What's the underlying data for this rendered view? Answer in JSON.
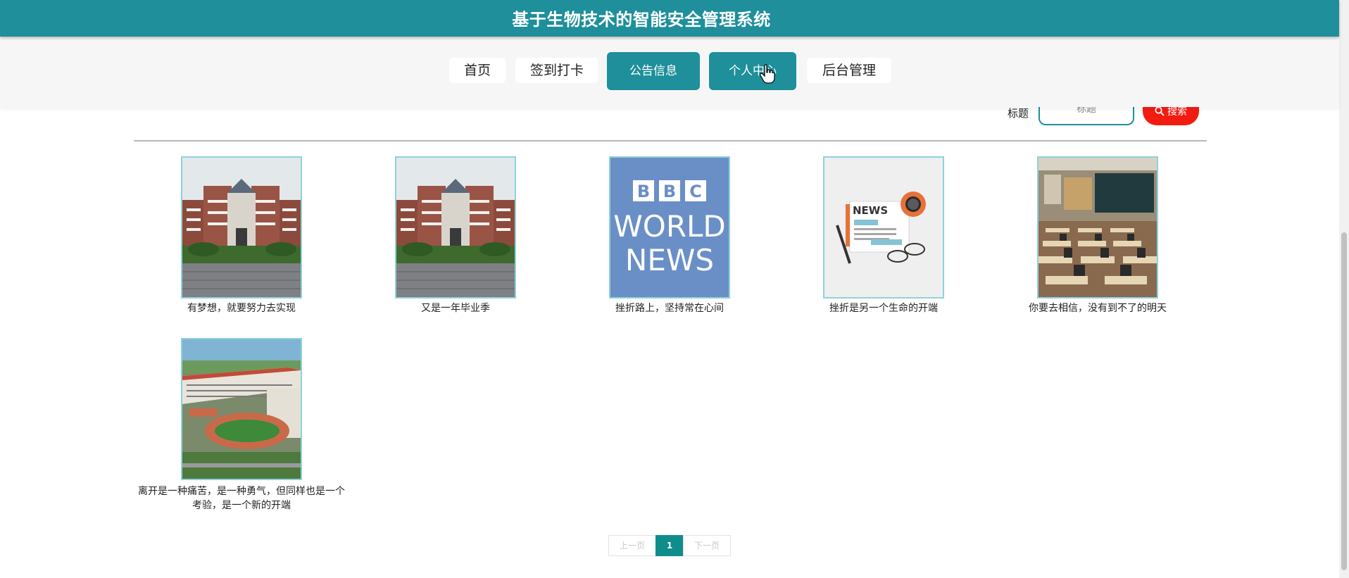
{
  "header": {
    "title": "基于生物技术的智能安全管理系统"
  },
  "nav": {
    "items": [
      {
        "label": "首页",
        "active": false
      },
      {
        "label": "签到打卡",
        "active": false
      },
      {
        "label": "公告信息",
        "active": true
      },
      {
        "label": "个人中心",
        "active": true
      },
      {
        "label": "后台管理",
        "active": false
      }
    ]
  },
  "search": {
    "label": "标题",
    "placeholder": "标题",
    "button_label": "搜索",
    "icon": "search-icon"
  },
  "cards": [
    {
      "caption": "有梦想，就要努力去实现",
      "image": "school-building"
    },
    {
      "caption": "又是一年毕业季",
      "image": "school-building"
    },
    {
      "caption": "挫折路上，坚持常在心间",
      "image": "bbc-world-news",
      "logo_text": [
        "B",
        "B",
        "C",
        "WORLD",
        "NEWS"
      ]
    },
    {
      "caption": "挫折是另一个生命的开端",
      "image": "news-illustration",
      "logo_text": [
        "NEWS"
      ]
    },
    {
      "caption": "你要去相信，没有到不了的明天",
      "image": "classroom"
    },
    {
      "caption": "离开是一种痛苦，是一种勇气，但同样也是一个考验，是一个新的开端",
      "image": "campus-aerial"
    }
  ],
  "pagination": {
    "prev": "上一页",
    "current": "1",
    "next": "下一页"
  },
  "colors": {
    "primary": "#1e8f9b",
    "search": "#f31c11",
    "pager_active": "#0f8c8c"
  }
}
